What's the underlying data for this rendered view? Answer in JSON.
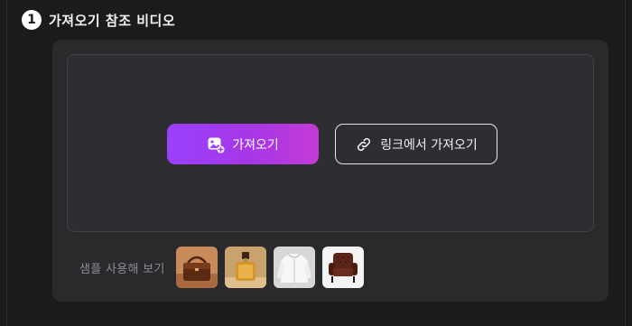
{
  "section": {
    "step_number": "1",
    "title": "가져오기 참조 비디오"
  },
  "upload": {
    "import_label": "가져오기",
    "import_icon": "image-add-icon",
    "link_label": "링크에서 가져오기",
    "link_icon": "link-icon"
  },
  "samples": {
    "label": "샘플 사용해 보기",
    "items": [
      {
        "name": "handbag",
        "bg": "#c98a5a"
      },
      {
        "name": "perfume",
        "bg": "#c9a270"
      },
      {
        "name": "white-jacket",
        "bg": "#d7d7d9"
      },
      {
        "name": "leather-armchair",
        "bg": "#f4f4f4"
      }
    ]
  },
  "colors": {
    "accent_start": "#9b40ff",
    "accent_end": "#c43ad6",
    "panel": "#2a2a2d",
    "background": "#1b1b1d"
  }
}
